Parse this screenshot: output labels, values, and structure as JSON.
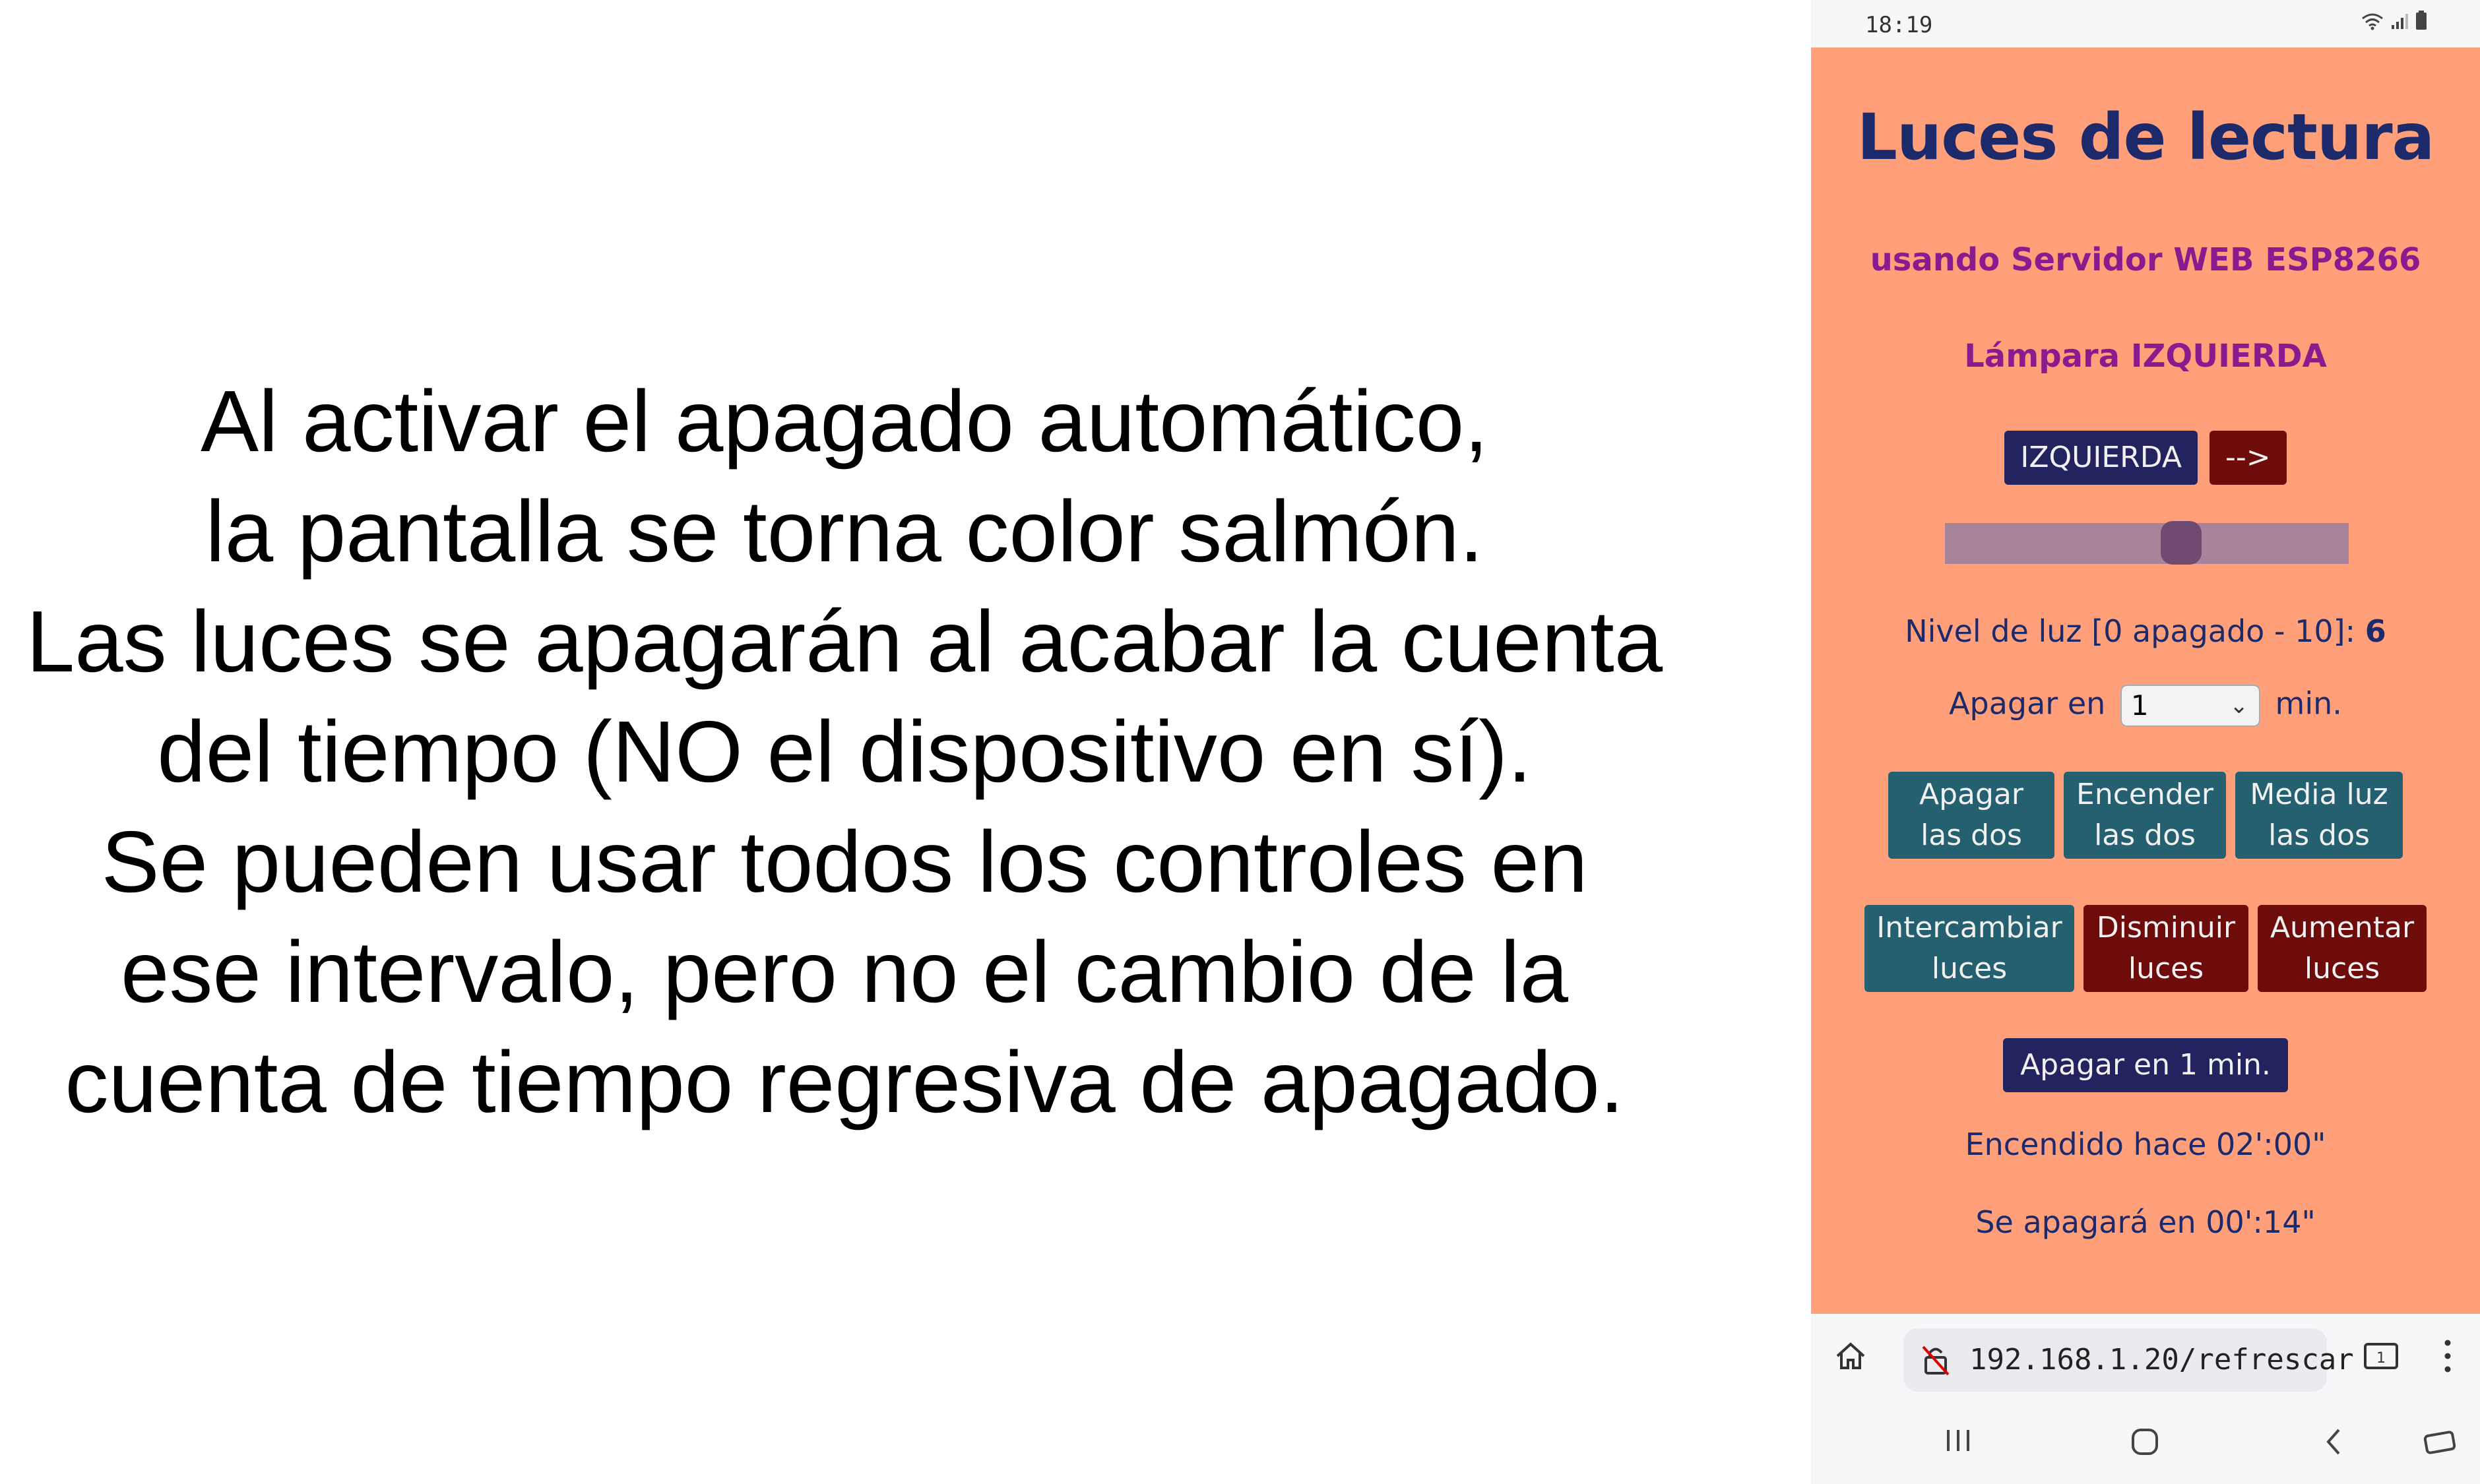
{
  "caption": {
    "lines": [
      "Al activar el  apagado automático,",
      "la pantalla se torna color salmón.",
      "Las luces se apagarán al acabar la cuenta",
      "del tiempo (NO el dispositivo en sí).",
      "Se pueden usar todos los controles en",
      "ese intervalo, pero no el cambio de la",
      "cuenta de tiempo regresiva de apagado."
    ]
  },
  "phone": {
    "status": {
      "time": "18:19"
    },
    "page": {
      "title": "Luces de lectura",
      "subtitle": "usando Servidor WEB ESP8266",
      "lamp_label": "Lámpara IZQUIERDA",
      "lamp_button": "IZQUIERDA",
      "next_button": "-->",
      "slider": {
        "min": 0,
        "max": 10,
        "value": 6
      },
      "level_label": "Nivel de luz [0 apagado - 10]:",
      "level_value": "6",
      "off_in_prefix": "Apagar en",
      "off_in_value": "1",
      "off_in_suffix": "min.",
      "buttons_row1": [
        {
          "line1": "Apagar",
          "line2": "las dos"
        },
        {
          "line1": "Encender",
          "line2": "las dos"
        },
        {
          "line1": "Media luz",
          "line2": "las dos"
        }
      ],
      "buttons_row2": [
        {
          "line1": "Intercambiar",
          "line2": "luces"
        },
        {
          "line1": "Disminuir",
          "line2": "luces"
        },
        {
          "line1": "Aumentar",
          "line2": "luces"
        }
      ],
      "timer_button": "Apagar en 1 min.",
      "on_since": "Encendido hace 02':00\"",
      "off_at": "Se apagará en 00':14\""
    },
    "browser": {
      "url": "192.168.1.20/refrescar",
      "tab_count": "1"
    },
    "colors": {
      "page_background": "#ffa07a",
      "title": "#1c2a6b",
      "subtitle": "#8a1b8f",
      "navy_button": "#232360",
      "maroon_button": "#6e0b0b",
      "teal_button": "#24606f"
    }
  }
}
